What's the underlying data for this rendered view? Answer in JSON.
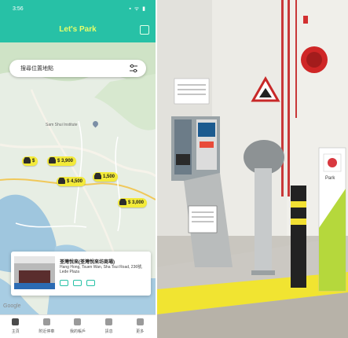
{
  "phone": {
    "status_time": "3:56",
    "status_icons": "▪ ᯤ ▮",
    "app_title": "Let's Park",
    "search_placeholder": "搜尋位置地點",
    "map_poi": "Sam Shui Institute",
    "markers": [
      {
        "label": "$"
      },
      {
        "label": "$ 3,900"
      },
      {
        "label": "1,500"
      },
      {
        "label": "$ 4,500"
      },
      {
        "label": "$ 3,000"
      }
    ],
    "card": {
      "name": "荃灣悅來(荃灣悅來坊商場)",
      "address": "Hang Hong, Tsuen Wan, Sha Tsui Road, 236號, Lede Plaza"
    },
    "google_label": "Google",
    "tabs": [
      "主頁",
      "附近停車",
      "我的帳戶",
      "訊息",
      "更多"
    ]
  },
  "photo": {
    "kiosk_brand": "Park"
  },
  "colors": {
    "brand_teal": "#27c1a6",
    "title_yellow": "#e6ff6b",
    "marker_yellow": "#f3ea3a"
  }
}
